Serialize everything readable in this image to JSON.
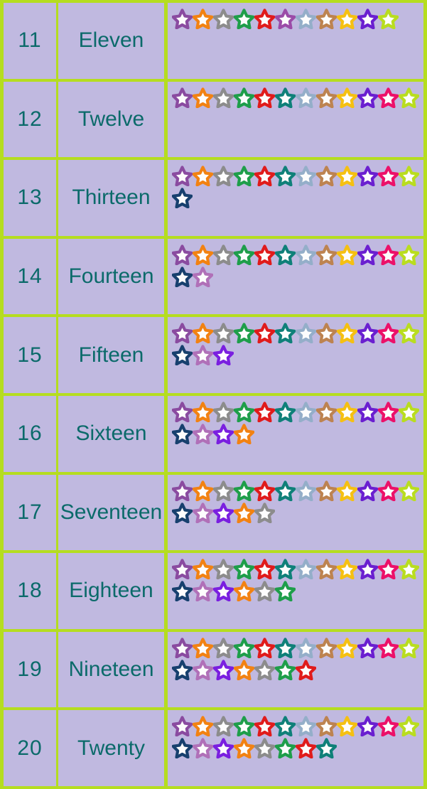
{
  "theme": {
    "cell_background": "#c0b9e0",
    "border_color": "#b5dd1f",
    "text_color": "#0b6a6a",
    "star_fill": "#fdfdfd"
  },
  "table": {
    "columns": [
      "numeral",
      "word",
      "stars"
    ],
    "rows": [
      {
        "numeral": "11",
        "word": "Eleven",
        "count": 11
      },
      {
        "numeral": "12",
        "word": "Twelve",
        "count": 12
      },
      {
        "numeral": "13",
        "word": "Thirteen",
        "count": 13
      },
      {
        "numeral": "14",
        "word": "Fourteen",
        "count": 14
      },
      {
        "numeral": "15",
        "word": "Fifteen",
        "count": 15
      },
      {
        "numeral": "16",
        "word": "Sixteen",
        "count": 16
      },
      {
        "numeral": "17",
        "word": "Seventeen",
        "count": 17
      },
      {
        "numeral": "18",
        "word": "Eighteen",
        "count": 18
      },
      {
        "numeral": "19",
        "word": "Nineteen",
        "count": 19
      },
      {
        "numeral": "20",
        "word": "Twenty",
        "count": 20
      }
    ]
  },
  "star_palette": [
    "#8a4ba0",
    "#f28212",
    "#8c8c8c",
    "#1e9e4a",
    "#e01b1b",
    "#0f8079",
    "#94aec9",
    "#bd8350",
    "#f5c012",
    "#6a1fd0",
    "#ec1069",
    "#b9dd1f",
    "#17406e",
    "#b070b8",
    "#7a1fe0",
    "#f28212",
    "#8c8c8c",
    "#1e9e4a",
    "#e01b1b",
    "#0f8079"
  ],
  "star_palette_overrides": {
    "row_11": {
      "6": "#9b4ba8",
      "11": "#b9dd1f"
    }
  }
}
